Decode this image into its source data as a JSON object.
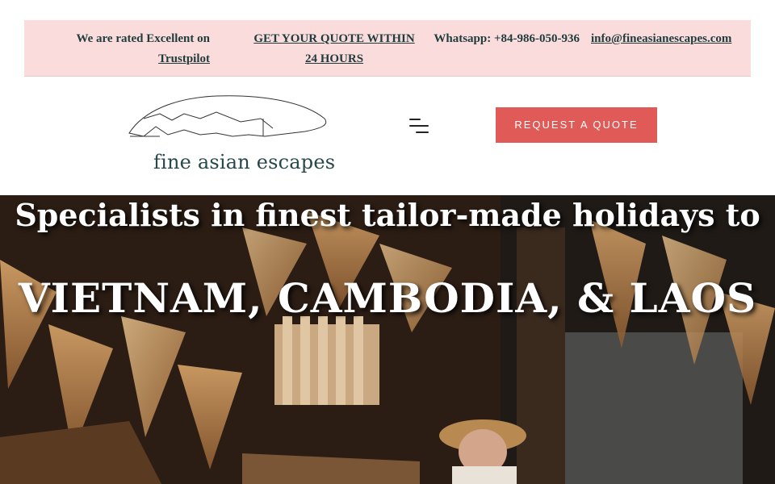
{
  "topbar": {
    "rated_text": "We are rated Excellent on",
    "rated_link": "Trustpilot",
    "quote_link": "GET YOUR QUOTE WITHIN 24 HOURS",
    "whatsapp": "Whatsapp: +84-986-050-936",
    "email": "info@fineasianescapes.com",
    "bg_color": "#fadcdc"
  },
  "header": {
    "logo_text": "fine asian escapes",
    "menu_icon": "hamburger-menu-icon",
    "quote_button": "REQUEST A QUOTE",
    "quote_button_color": "#e05a57"
  },
  "hero": {
    "line1": "Specialists in finest tailor-made holidays to",
    "line2": "VIETNAM, CAMBODIA, & LAOS"
  }
}
